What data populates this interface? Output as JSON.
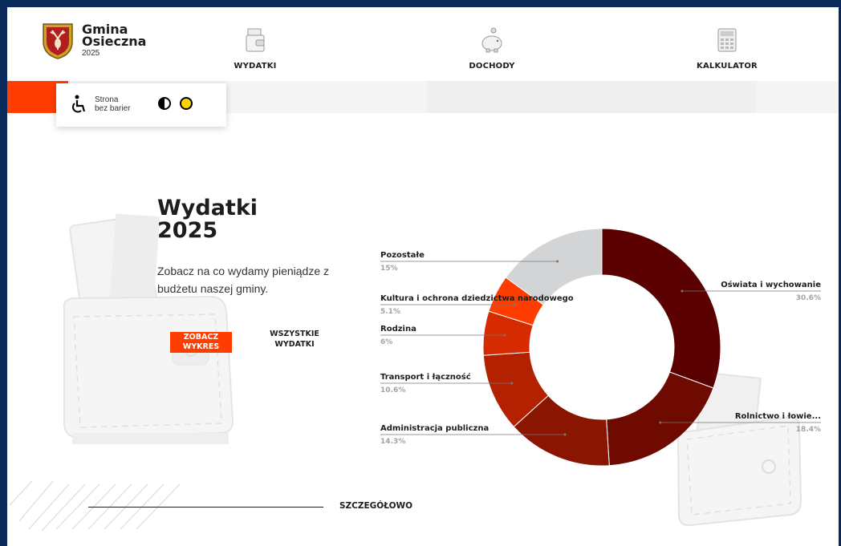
{
  "brand": {
    "name_line1": "Gmina",
    "name_line2": "Osieczna",
    "year": "2025"
  },
  "nav": [
    {
      "label": "WYDATKI",
      "icon": "wallet-icon"
    },
    {
      "label": "DOCHODY",
      "icon": "piggy-bank-icon"
    },
    {
      "label": "KALKULATOR",
      "icon": "calculator-icon"
    }
  ],
  "accessibility": {
    "line1": "Strona",
    "line2": "bez barier"
  },
  "hero": {
    "title_line1": "Wydatki",
    "title_line2": "2025",
    "lead": "Zobacz na co wydamy pieniądze z budżetu naszej gminy.",
    "btn_chart_line1": "ZOBACZ",
    "btn_chart_line2": "WYKRES",
    "btn_all_line1": "WSZYSTKIE",
    "btn_all_line2": "WYDATKI"
  },
  "more_label": "SZCZEGÓŁOWO",
  "colors": {
    "accent": "#ff3d00",
    "frame": "#0b2a5c"
  },
  "chart_data": {
    "type": "pie",
    "categories": [
      "Oświata i wychowanie",
      "Rolnictwo i łowie...",
      "Administracja publiczna",
      "Transport i łączność",
      "Rodzina",
      "Kultura i ochrona dziedzictwa narodowego",
      "Pozostałe"
    ],
    "values": [
      30.6,
      18.4,
      14.3,
      10.6,
      6.0,
      5.1,
      15.0
    ],
    "value_labels": [
      "30.6%",
      "18.4%",
      "14.3%",
      "10.6%",
      "6%",
      "5.1%",
      "15%"
    ],
    "colors": [
      "#5a0000",
      "#6e0a00",
      "#8a1500",
      "#b32100",
      "#d62a00",
      "#ff3d00",
      "#d2d4d6"
    ],
    "donut": true
  }
}
